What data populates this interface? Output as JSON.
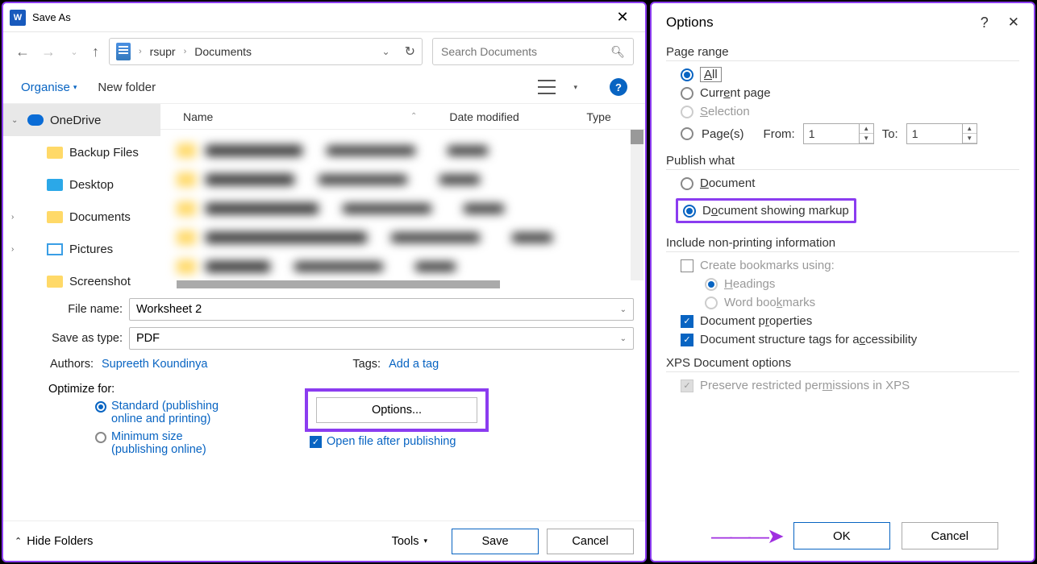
{
  "saveAs": {
    "title": "Save As",
    "nav": {
      "path1": "rsupr",
      "path2": "Documents",
      "searchPlaceholder": "Search Documents"
    },
    "toolbar": {
      "organise": "Organise",
      "newFolder": "New folder"
    },
    "sidebar": {
      "items": [
        {
          "label": "OneDrive",
          "icon": "cloud",
          "expanded": true,
          "selected": true
        },
        {
          "label": "Backup Files",
          "icon": "folder"
        },
        {
          "label": "Desktop",
          "icon": "desktop"
        },
        {
          "label": "Documents",
          "icon": "folder",
          "hasChev": true
        },
        {
          "label": "Pictures",
          "icon": "pic",
          "hasChev": true
        },
        {
          "label": "Screenshot",
          "icon": "folder"
        }
      ]
    },
    "headers": {
      "name": "Name",
      "date": "Date modified",
      "type": "Type"
    },
    "form": {
      "fileNameLabel": "File name:",
      "fileName": "Worksheet 2",
      "typeLabel": "Save as type:",
      "type": "PDF",
      "authorsLabel": "Authors:",
      "authors": "Supreeth Koundinya",
      "tagsLabel": "Tags:",
      "tags": "Add a tag",
      "optimizeLabel": "Optimize for:",
      "opt1a": "Standard (publishing",
      "opt1b": "online and printing)",
      "opt2a": "Minimum size",
      "opt2b": "(publishing online)",
      "optionsBtn": "Options...",
      "openAfter": "Open file after publishing"
    },
    "bottom": {
      "hideFolders": "Hide Folders",
      "tools": "Tools",
      "save": "Save",
      "cancel": "Cancel"
    }
  },
  "options": {
    "title": "Options",
    "pageRange": {
      "head": "Page range",
      "all": "All",
      "current": "Current page",
      "selection": "Selection",
      "pages": "Page(s)",
      "from": "From:",
      "to": "To:",
      "fromVal": "1",
      "toVal": "1"
    },
    "publish": {
      "head": "Publish what",
      "doc": "Document",
      "docMarkup": "Document showing markup"
    },
    "nonprint": {
      "head": "Include non-printing information",
      "bookmarks": "Create bookmarks using:",
      "headings": "Headings",
      "wordBm": "Word bookmarks",
      "props": "Document properties",
      "struct": "Document structure tags for accessibility"
    },
    "xps": {
      "head": "XPS Document options",
      "preserve": "Preserve restricted permissions in XPS"
    },
    "buttons": {
      "ok": "OK",
      "cancel": "Cancel"
    }
  }
}
